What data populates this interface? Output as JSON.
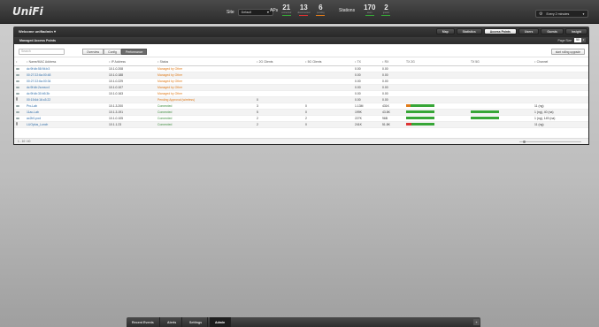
{
  "app": {
    "logo": "UniFi"
  },
  "topbar": {
    "site_label": "Site",
    "site_value": "Default",
    "aps_label": "APs",
    "aps": [
      {
        "value": "21",
        "sub": "connected",
        "color": "#37a637"
      },
      {
        "value": "13",
        "sub": "disconnected",
        "color": "#d33"
      },
      {
        "value": "6",
        "sub": "pending",
        "color": "#e07b1a"
      }
    ],
    "stations_label": "Stations",
    "stations": [
      {
        "value": "170",
        "sub": "users",
        "color": "#37a637"
      },
      {
        "value": "2",
        "sub": "guests",
        "color": "#37a637"
      }
    ],
    "refresh_label": "Every 2 minutes"
  },
  "header": {
    "welcome": "Welcome unifiadmin",
    "tabs": [
      "Map",
      "Statistics",
      "Access Points",
      "Users",
      "Guests",
      "Insight"
    ],
    "active_tab": "Access Points"
  },
  "panel": {
    "title": "Managed Access Points",
    "page_size_label": "Page Size",
    "page_size": "50",
    "search_placeholder": "Search",
    "views": [
      "Overview",
      "Config",
      "Performance"
    ],
    "active_view": "Performance",
    "upgrade_button": "start rolling upgrade",
    "columns": [
      "",
      "Name/MAC Address",
      "IP Address",
      "Status",
      "2G Clients",
      "5G Clients",
      "TX",
      "RX",
      "TX 2G",
      "TX 5G",
      "Channel"
    ],
    "rows": [
      {
        "icon": "ap-icon",
        "name": "dc:9f:db:58:94:b3",
        "ip": "10.1.0.208",
        "status": "Managed by Other",
        "status_class": "st-other",
        "c2g": "",
        "c5g": "",
        "tx": "0.00",
        "rx": "0.00",
        "tx2g": null,
        "tx5g": null,
        "channel": ""
      },
      {
        "icon": "ap-icon",
        "name": "00:27:22:6a:00:48",
        "ip": "10.1.0.188",
        "status": "Managed by Other",
        "status_class": "st-other",
        "c2g": "",
        "c5g": "",
        "tx": "0.00",
        "rx": "0.00",
        "tx2g": null,
        "tx5g": null,
        "channel": ""
      },
      {
        "icon": "ap-icon",
        "name": "00:27:22:6a:00:34",
        "ip": "10.1.0.229",
        "status": "Managed by Other",
        "status_class": "st-other",
        "c2g": "",
        "c5g": "",
        "tx": "0.00",
        "rx": "0.00",
        "tx2g": null,
        "tx5g": null,
        "channel": ""
      },
      {
        "icon": "ap-icon",
        "name": "dc:9f:db:2a:ea:c4",
        "ip": "10.1.0.107",
        "status": "Managed by Other",
        "status_class": "st-other",
        "c2g": "",
        "c5g": "",
        "tx": "0.00",
        "rx": "0.00",
        "tx2g": null,
        "tx5g": null,
        "channel": ""
      },
      {
        "icon": "ap-icon",
        "name": "dc:9f:db:30:b5:3b",
        "ip": "10.1.0.163",
        "status": "Managed by Other",
        "status_class": "st-other",
        "c2g": "",
        "c5g": "",
        "tx": "0.00",
        "rx": "0.00",
        "tx2g": null,
        "tx5g": null,
        "channel": ""
      },
      {
        "icon": "box-icon",
        "name": "00:15:6d:16:c3:22",
        "ip": "",
        "status": "Pending Approval (wireless)",
        "status_class": "st-pending",
        "c2g": "0",
        "c5g": "",
        "tx": "0.00",
        "rx": "0.00",
        "tx2g": null,
        "tx5g": null,
        "channel": ""
      },
      {
        "icon": "ap-icon",
        "name": "Pro-Lab",
        "ip": "10.1.3.200",
        "status": "Connected",
        "status_class": "st-connected",
        "c2g": "3",
        "c5g": "0",
        "tx": "1.13M",
        "rx": "431K",
        "tx2g": {
          "used": 0.15,
          "color": "#e07b1a"
        },
        "tx5g": null,
        "channel": "11 (ng)"
      },
      {
        "icon": "ap-icon",
        "name": "11ac-Lab",
        "ip": "10.1.3.191",
        "status": "Connected",
        "status_class": "st-connected",
        "c2g": "5",
        "c5g": "0",
        "tx": "199K",
        "rx": "43.8K",
        "tx2g": {
          "used": 0.0,
          "color": "#d33"
        },
        "tx5g": {
          "used": 0.0,
          "color": "#d33"
        },
        "channel": "1 (ng), 40 (na)"
      },
      {
        "icon": "ap-icon",
        "name": "ac2lr0-pod",
        "ip": "10.1.0.105",
        "status": "Connected",
        "status_class": "st-connected",
        "c2g": "2",
        "c5g": "2",
        "tx": "227K",
        "rx": "96B",
        "tx2g": {
          "used": 0.0,
          "color": "#d33"
        },
        "tx5g": {
          "used": 0.0,
          "color": "#d33"
        },
        "channel": "1 (ng), 149 (na)"
      },
      {
        "icon": "box-icon",
        "name": "LUOplus_Lunch",
        "ip": "10.1.1.23",
        "status": "Connected",
        "status_class": "st-connected",
        "c2g": "2",
        "c5g": "0",
        "tx": "241K",
        "rx": "51.8K",
        "tx2g": {
          "used": 0.2,
          "color": "#d33"
        },
        "tx5g": null,
        "channel": "11 (ng)"
      }
    ],
    "pager": "1 - 10 / 40"
  },
  "bottom": {
    "tabs": [
      "Recent Events",
      "Alerts",
      "Settings",
      "Admin"
    ],
    "active_tab": "Admin",
    "expand": "+"
  }
}
